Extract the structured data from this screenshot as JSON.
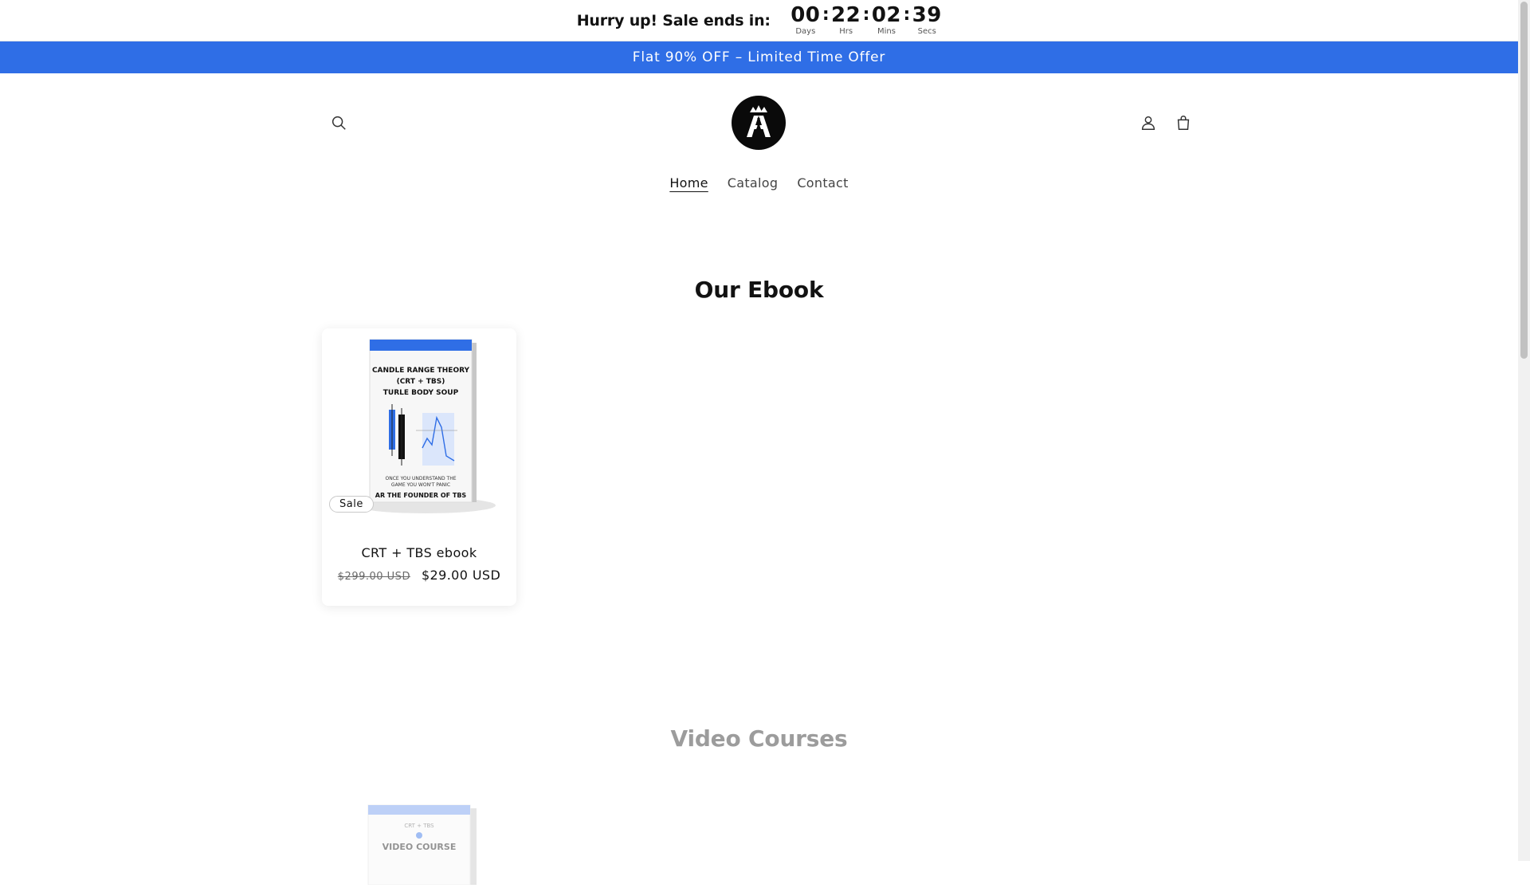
{
  "countdown": {
    "heading": "Hurry up! Sale ends in:",
    "days": "00",
    "days_label": "Days",
    "hours": "22",
    "hours_label": "Hrs",
    "minutes": "02",
    "minutes_label": "Mins",
    "seconds": "39",
    "seconds_label": "Secs",
    "separator": ":"
  },
  "announcement": {
    "text": "Flat 90% OFF – Limited Time Offer"
  },
  "nav": {
    "items": [
      {
        "label": "Home",
        "active": true
      },
      {
        "label": "Catalog",
        "active": false
      },
      {
        "label": "Contact",
        "active": false
      }
    ]
  },
  "sections": {
    "ebook_title": "Our Ebook",
    "video_title": "Video Courses"
  },
  "product": {
    "badge": "Sale",
    "title": "CRT + TBS ebook",
    "price_old": "$299.00 USD",
    "price_new": "$29.00 USD",
    "cover": {
      "line1": "CANDLE RANGE THEORY",
      "line2": "(CRT + TBS)",
      "line3": "TURLE BODY SOUP",
      "tagline1": "ONCE YOU UNDERSTAND THE",
      "tagline2": "GAME YOU WON'T PANIC",
      "author": "AR THE FOUNDER OF TBS"
    }
  },
  "video_product": {
    "cover_line1": "CRT + TBS",
    "cover_line2": "VIDEO COURSE"
  },
  "colors": {
    "accent": "#2f6ee6",
    "text": "#121212"
  },
  "icons": {
    "search": "search-icon",
    "account": "account-icon",
    "cart": "cart-icon"
  }
}
